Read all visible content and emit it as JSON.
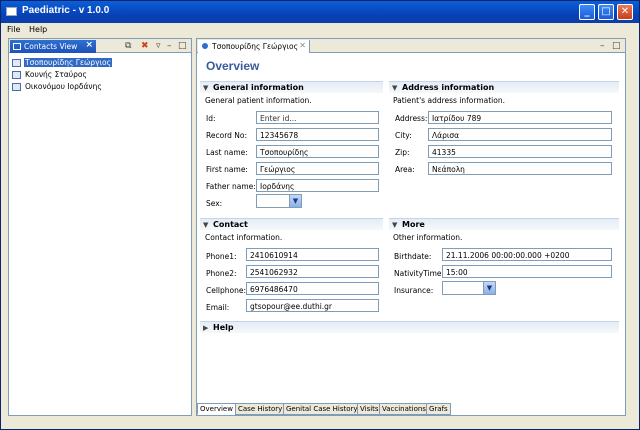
{
  "window": {
    "title": "Paediatric - v 1.0.0"
  },
  "window_controls": {
    "minimize": "_",
    "maximize": "□",
    "close": "✕"
  },
  "menu": {
    "items": [
      "File",
      "Help"
    ]
  },
  "contacts_view": {
    "tab_label": "Contacts View",
    "items": [
      "Τσοπουρίδης Γεώργιος",
      "Κουνής Σταύρος",
      "Οικονόμου Ιορδάνης"
    ],
    "selected_index": 0
  },
  "editor": {
    "tab_label": "Τσοπουρίδης Γεώργιος",
    "form_title": "Overview",
    "general": {
      "title": "General information",
      "description": "General patient information.",
      "labels": {
        "id": "Id:",
        "record_no": "Record No:",
        "last_name": "Last name:",
        "first_name": "First name:",
        "father_name": "Father name:",
        "sex": "Sex:"
      },
      "values": {
        "id": "Enter id...",
        "record_no": "12345678",
        "last_name": "Τσοπουρίδης",
        "first_name": "Γεώργιος",
        "father_name": "Ιορδάνης",
        "sex": ""
      }
    },
    "address": {
      "title": "Address information",
      "description": "Patient's address information.",
      "labels": {
        "address": "Address:",
        "city": "City:",
        "zip": "Zip:",
        "area": "Area:"
      },
      "values": {
        "address": "Ιατρίδου 789",
        "city": "Λάρισα",
        "zip": "41335",
        "area": "Νεάπολη"
      }
    },
    "contact": {
      "title": "Contact",
      "description": "Contact information.",
      "labels": {
        "phone1": "Phone1:",
        "phone2": "Phone2:",
        "cellphone": "Cellphone:",
        "email": "Email:"
      },
      "values": {
        "phone1": "2410610914",
        "phone2": "2541062932",
        "cellphone": "6976486470",
        "email": "gtsopour@ee.duthi.gr"
      }
    },
    "more": {
      "title": "More",
      "description": "Other information.",
      "labels": {
        "birthdate": "Birthdate:",
        "nativity_time": "NativityTime:",
        "insurance": "Insurance:"
      },
      "values": {
        "birthdate": "21.11.2006 00:00:00.000 +0200",
        "nativity_time": "15:00",
        "insurance": ""
      }
    },
    "help": {
      "title": "Help"
    },
    "bottom_tabs": [
      "Overview",
      "Case History",
      "Genital Case History",
      "Visits",
      "Vaccinations",
      "Grafs"
    ],
    "active_bottom_tab": 0
  },
  "colors": {
    "title_bar": "#0a5fd8",
    "selection": "#316ac5",
    "form_title": "#3a5a9a"
  }
}
